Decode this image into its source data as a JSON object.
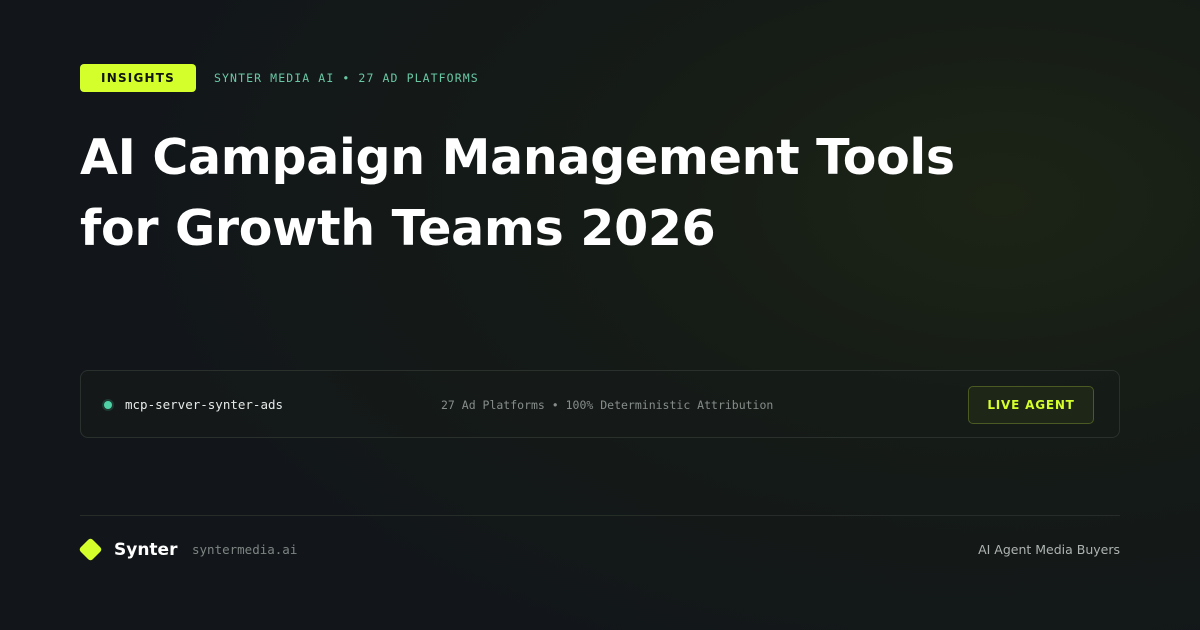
{
  "header": {
    "badge": "INSIGHTS",
    "eyebrow": "SYNTER MEDIA AI • 27 AD PLATFORMS"
  },
  "headline": {
    "line1": "AI Campaign Management Tools",
    "line2": "for Growth Teams 2026"
  },
  "server_card": {
    "status_icon": "status-dot-icon",
    "name": "mcp-server-synter-ads",
    "stats": "27 Ad Platforms • 100% Deterministic Attribution",
    "button_label": "LIVE AGENT"
  },
  "footer": {
    "logo_icon": "diamond-logo-icon",
    "brand": "Synter",
    "url": "syntermedia.ai",
    "tagline": "AI Agent Media Buyers"
  },
  "colors": {
    "accent": "#d4ff2a",
    "teal": "#69c7a4",
    "status": "#4fd1a5",
    "background": "#12161a"
  }
}
